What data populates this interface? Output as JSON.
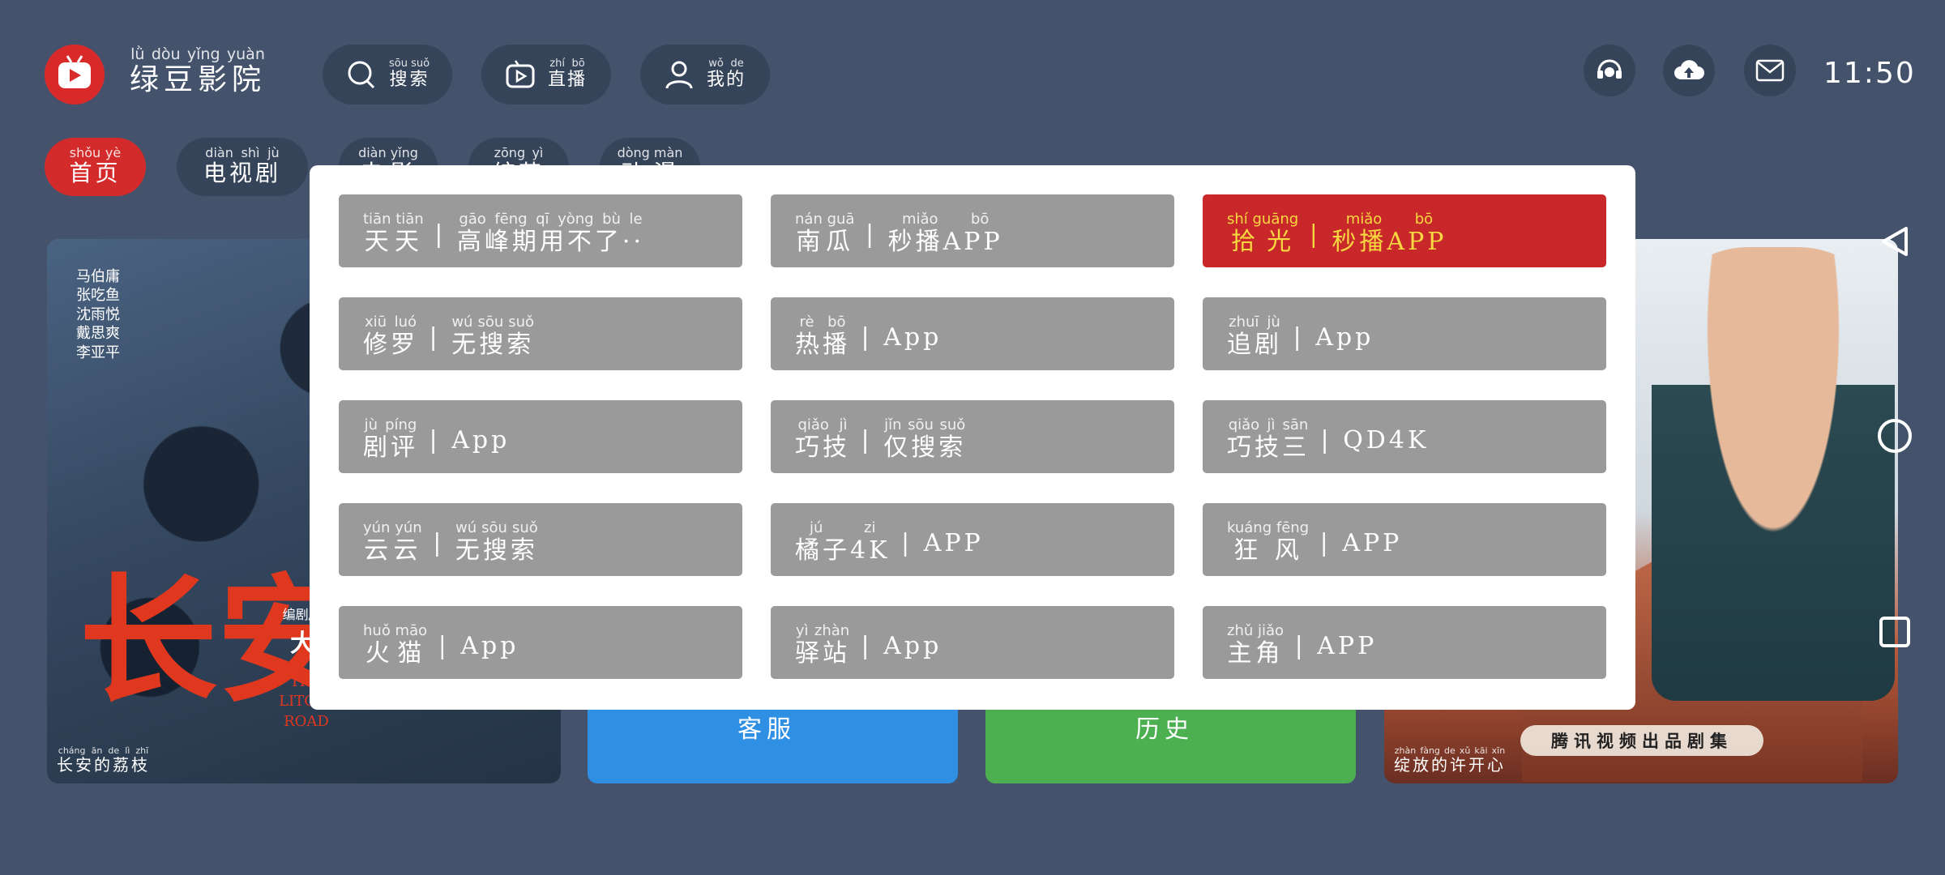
{
  "header": {
    "app_name": "绿豆影院",
    "app_name_pinyin": "lǜ dòu yǐng yuàn",
    "time": "11:50",
    "buttons": [
      {
        "label": "搜索",
        "pinyin": "sōu suǒ",
        "icon": "search-icon"
      },
      {
        "label": "直播",
        "pinyin": "zhí bō",
        "icon": "live-tv-icon"
      },
      {
        "label": "我的",
        "pinyin": "wǒ de",
        "icon": "user-icon"
      }
    ],
    "icons": [
      "support-headset-icon",
      "cloud-upload-icon",
      "mail-icon"
    ]
  },
  "categories": [
    {
      "label": "首页",
      "pinyin": "shǒu yè",
      "active": true
    },
    {
      "label": "电视剧",
      "pinyin": "diàn shì jù",
      "active": false
    },
    {
      "label": "电影",
      "pinyin": "diàn yǐng",
      "active": false
    },
    {
      "label": "综艺",
      "pinyin": "zōng yì",
      "active": false
    },
    {
      "label": "动漫",
      "pinyin": "dòng màn",
      "active": false
    }
  ],
  "posters": {
    "left": {
      "caption": "长安的荔枝",
      "caption_pinyin": "cháng ān de lì zhī",
      "title_art": "长安的",
      "credits": [
        "马伯庸",
        "张吃鱼",
        "沈雨悦",
        "戴思爽",
        "李亚平"
      ],
      "director_label": "编剧/导演",
      "director": "大鹏",
      "english_title": "THE LITCHI ROAD"
    },
    "right": {
      "caption": "绽放的许开心",
      "caption_pinyin": "zhàn fàng de xǔ kāi xīn",
      "tag": "腾讯视频出品剧集"
    }
  },
  "tiles": {
    "blue_label": "客服",
    "green_label": "历史"
  },
  "source_list": {
    "selected_index": 2,
    "items": [
      {
        "name": "天天",
        "name_pinyin": "tiān tiān",
        "sep": "|",
        "desc": "高峰期用不了··",
        "desc_pinyin": "gāo fēng qī yòng bù le"
      },
      {
        "name": "南瓜",
        "name_pinyin": "nán guā",
        "sep": "|",
        "desc": "秒播APP",
        "desc_pinyin": "miǎo bō"
      },
      {
        "name": "拾光",
        "name_pinyin": "shí guāng",
        "sep": "|",
        "desc": "秒播APP",
        "desc_pinyin": "miǎo bō"
      },
      {
        "name": "修罗",
        "name_pinyin": "xiū luó",
        "sep": "|",
        "desc": "无搜索",
        "desc_pinyin": "wú sōu suǒ"
      },
      {
        "name": "热播",
        "name_pinyin": "rè bō",
        "sep": "|",
        "desc": "App",
        "desc_pinyin": ""
      },
      {
        "name": "追剧",
        "name_pinyin": "zhuī jù",
        "sep": "|",
        "desc": "App",
        "desc_pinyin": ""
      },
      {
        "name": "剧评",
        "name_pinyin": "jù píng",
        "sep": "|",
        "desc": "App",
        "desc_pinyin": ""
      },
      {
        "name": "巧技",
        "name_pinyin": "qiǎo jì",
        "sep": "|",
        "desc": "仅搜索",
        "desc_pinyin": "jǐn sōu suǒ"
      },
      {
        "name": "巧技三",
        "name_pinyin": "qiǎo jì sān",
        "sep": "|",
        "desc": "QD4K",
        "desc_pinyin": ""
      },
      {
        "name": "云云",
        "name_pinyin": "yún yún",
        "sep": "|",
        "desc": "无搜索",
        "desc_pinyin": "wú sōu suǒ"
      },
      {
        "name": "橘子4K",
        "name_pinyin": "jú zi",
        "sep": "|",
        "desc": "APP",
        "desc_pinyin": ""
      },
      {
        "name": "狂风",
        "name_pinyin": "kuáng fēng",
        "sep": "|",
        "desc": "APP",
        "desc_pinyin": ""
      },
      {
        "name": "火猫",
        "name_pinyin": "huǒ māo",
        "sep": "|",
        "desc": "App",
        "desc_pinyin": ""
      },
      {
        "name": "驿站",
        "name_pinyin": "yì zhàn",
        "sep": "|",
        "desc": "App",
        "desc_pinyin": ""
      },
      {
        "name": "主角",
        "name_pinyin": "zhǔ jiǎo",
        "sep": "|",
        "desc": "APP",
        "desc_pinyin": ""
      }
    ]
  },
  "side_nav": [
    "back-triangle-icon",
    "home-circle-icon",
    "recents-square-icon"
  ],
  "colors": {
    "background": "#44536b",
    "pill": "#36445a",
    "accent_red": "#d32b2b",
    "selected_text": "#f8d840",
    "item_gray": "#9a9a9a"
  }
}
